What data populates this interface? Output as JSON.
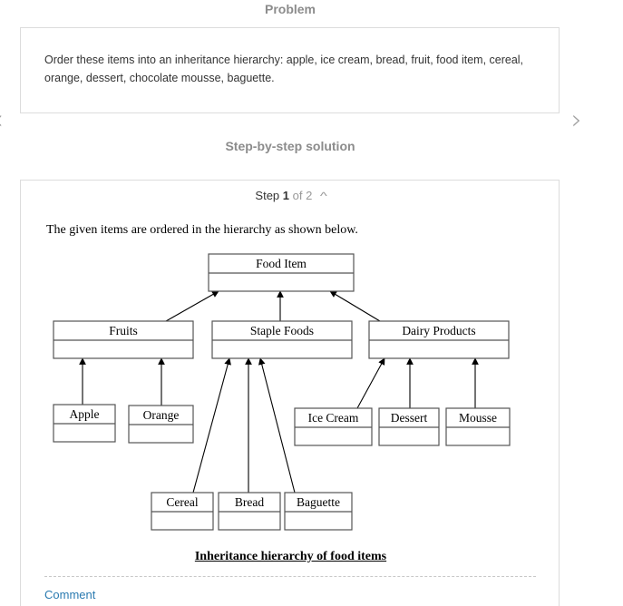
{
  "problem": {
    "title": "Problem",
    "text": "Order these items into an inheritance hierarchy: apple, ice cream, bread, fruit, food item, cereal, orange, dessert, chocolate mousse, baguette."
  },
  "navigation": {
    "prev_icon": "chevron-left-icon",
    "next_icon": "chevron-right-icon",
    "prev_glyph": "‹",
    "next_glyph": "›"
  },
  "solution": {
    "title": "Step-by-step solution",
    "step": {
      "label": "Step",
      "current": "1",
      "of_label": "of 2",
      "collapse_glyph": "^"
    },
    "intro": "The given items are ordered in the hierarchy as shown below.",
    "diagram": {
      "nodes": [
        {
          "id": "food-item",
          "label": "Food Item",
          "parent": null
        },
        {
          "id": "fruits",
          "label": "Fruits",
          "parent": "food-item"
        },
        {
          "id": "staple-foods",
          "label": "Staple Foods",
          "parent": "food-item"
        },
        {
          "id": "dairy-products",
          "label": "Dairy Products",
          "parent": "food-item"
        },
        {
          "id": "apple",
          "label": "Apple",
          "parent": "fruits"
        },
        {
          "id": "orange",
          "label": "Orange",
          "parent": "fruits"
        },
        {
          "id": "cereal",
          "label": "Cereal",
          "parent": "staple-foods"
        },
        {
          "id": "bread",
          "label": "Bread",
          "parent": "staple-foods"
        },
        {
          "id": "baguette",
          "label": "Baguette",
          "parent": "staple-foods"
        },
        {
          "id": "ice-cream",
          "label": "Ice Cream",
          "parent": "dairy-products"
        },
        {
          "id": "dessert",
          "label": "Dessert",
          "parent": "dairy-products"
        },
        {
          "id": "mousse",
          "label": "Mousse",
          "parent": "dairy-products"
        }
      ]
    },
    "caption": "Inheritance hierarchy of food items",
    "comment_label": "Comment"
  }
}
